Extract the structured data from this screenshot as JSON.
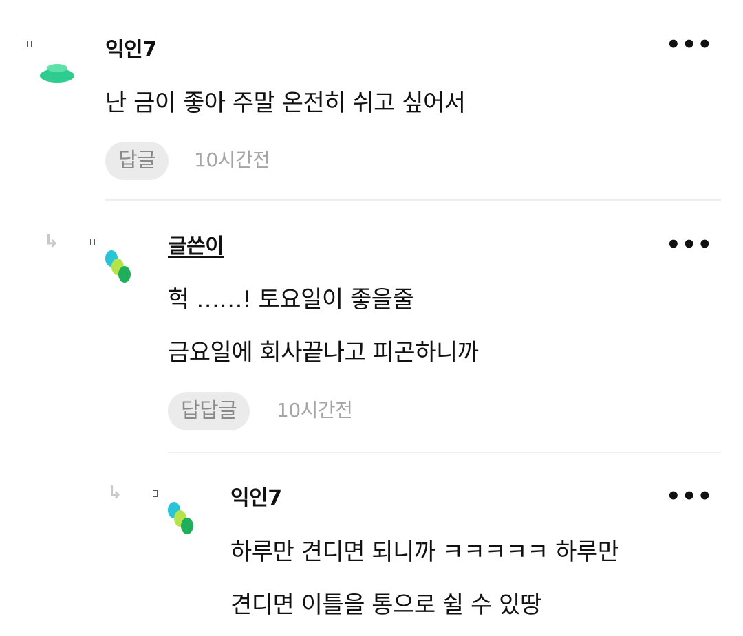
{
  "comments": [
    {
      "author": "익인7",
      "lines": [
        "난 금이 좋아 주말 온전히 쉬고 싶어서"
      ],
      "reply_label": "답글",
      "time": "10시간전",
      "more_icon": "more-horizontal-icon",
      "avatar_icon": "green-disc-avatar-icon"
    },
    {
      "author": "글쓴이",
      "lines": [
        "헉 ……! 토요일이 좋을줄",
        "금요일에 회사끝나고 피곤하니까"
      ],
      "reply_label": "답답글",
      "time": "10시간전",
      "more_icon": "more-horizontal-icon",
      "avatar_icon": "overlapping-circles-avatar-icon"
    },
    {
      "author": "익인7",
      "lines": [
        "하루만 견디면 되니까 ㅋㅋㅋㅋㅋ 하루만",
        "견디면 이틀을 통으로 쉴 수 있땅"
      ],
      "more_icon": "more-horizontal-icon",
      "avatar_icon": "overlapping-circles-avatar-icon"
    }
  ],
  "colors": {
    "reply_button_bg": "#ebebeb",
    "avatar_green": "#2ecc8f",
    "avatar_cyan": "#29c4d8",
    "avatar_lime": "#b7e34a",
    "avatar_dark_green": "#1fae5a"
  }
}
